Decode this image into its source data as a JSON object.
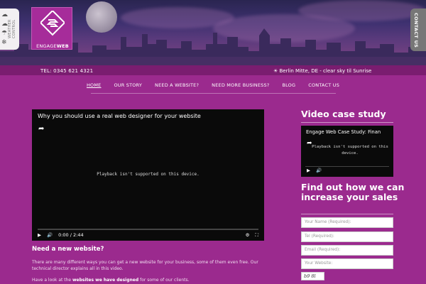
{
  "header": {
    "weather_control_label": "WEATHER CONTROL",
    "weather_icons": [
      "cloud-sun-icon",
      "cloud-icon",
      "rain-icon",
      "snow-icon"
    ],
    "logo_text_light": "ENGAGE",
    "logo_text_bold": "WEB",
    "contact_tab": "CONTACT US",
    "tel": "TEL: 0345 621 4321",
    "location": "☀ Berlin Mitte, DE - clear sky   til  Sunrise"
  },
  "nav": {
    "items": [
      "HOME",
      "OUR STORY",
      "NEED A WEBSITE?",
      "NEED MORE BUSINESS?",
      "BLOG",
      "CONTACT US"
    ],
    "active": "HOME"
  },
  "main": {
    "video": {
      "title": "Why you should use a real web designer for your website",
      "message": "Playback isn't supported on this device.",
      "time": "0:00 / 2:44"
    },
    "heading": "Need a new website?",
    "para1": "There are many different ways you can get a new website for your business, some of them even free. Our technical director explains all in this video.",
    "para2_before": "Have a look at the ",
    "para2_link": "websites we have designed",
    "para2_after": " for some of our clients."
  },
  "sidebar": {
    "video_heading": "Video case study",
    "video": {
      "title": "Engage Web Case Study: Finan",
      "message": "Playback isn't supported on this device."
    },
    "form_heading": "Find out how we can increase your sales",
    "form": {
      "name_placeholder": "Your Name (Required):",
      "tel_placeholder": "Tel (Required):",
      "email_placeholder": "Email (Required):",
      "website_placeholder": "Your Website:",
      "captcha_text": "b9 8l"
    }
  },
  "colors": {
    "background": "#9b2a8e",
    "header_band": "#7a1d70",
    "logo_bg": "#a62c9a"
  }
}
